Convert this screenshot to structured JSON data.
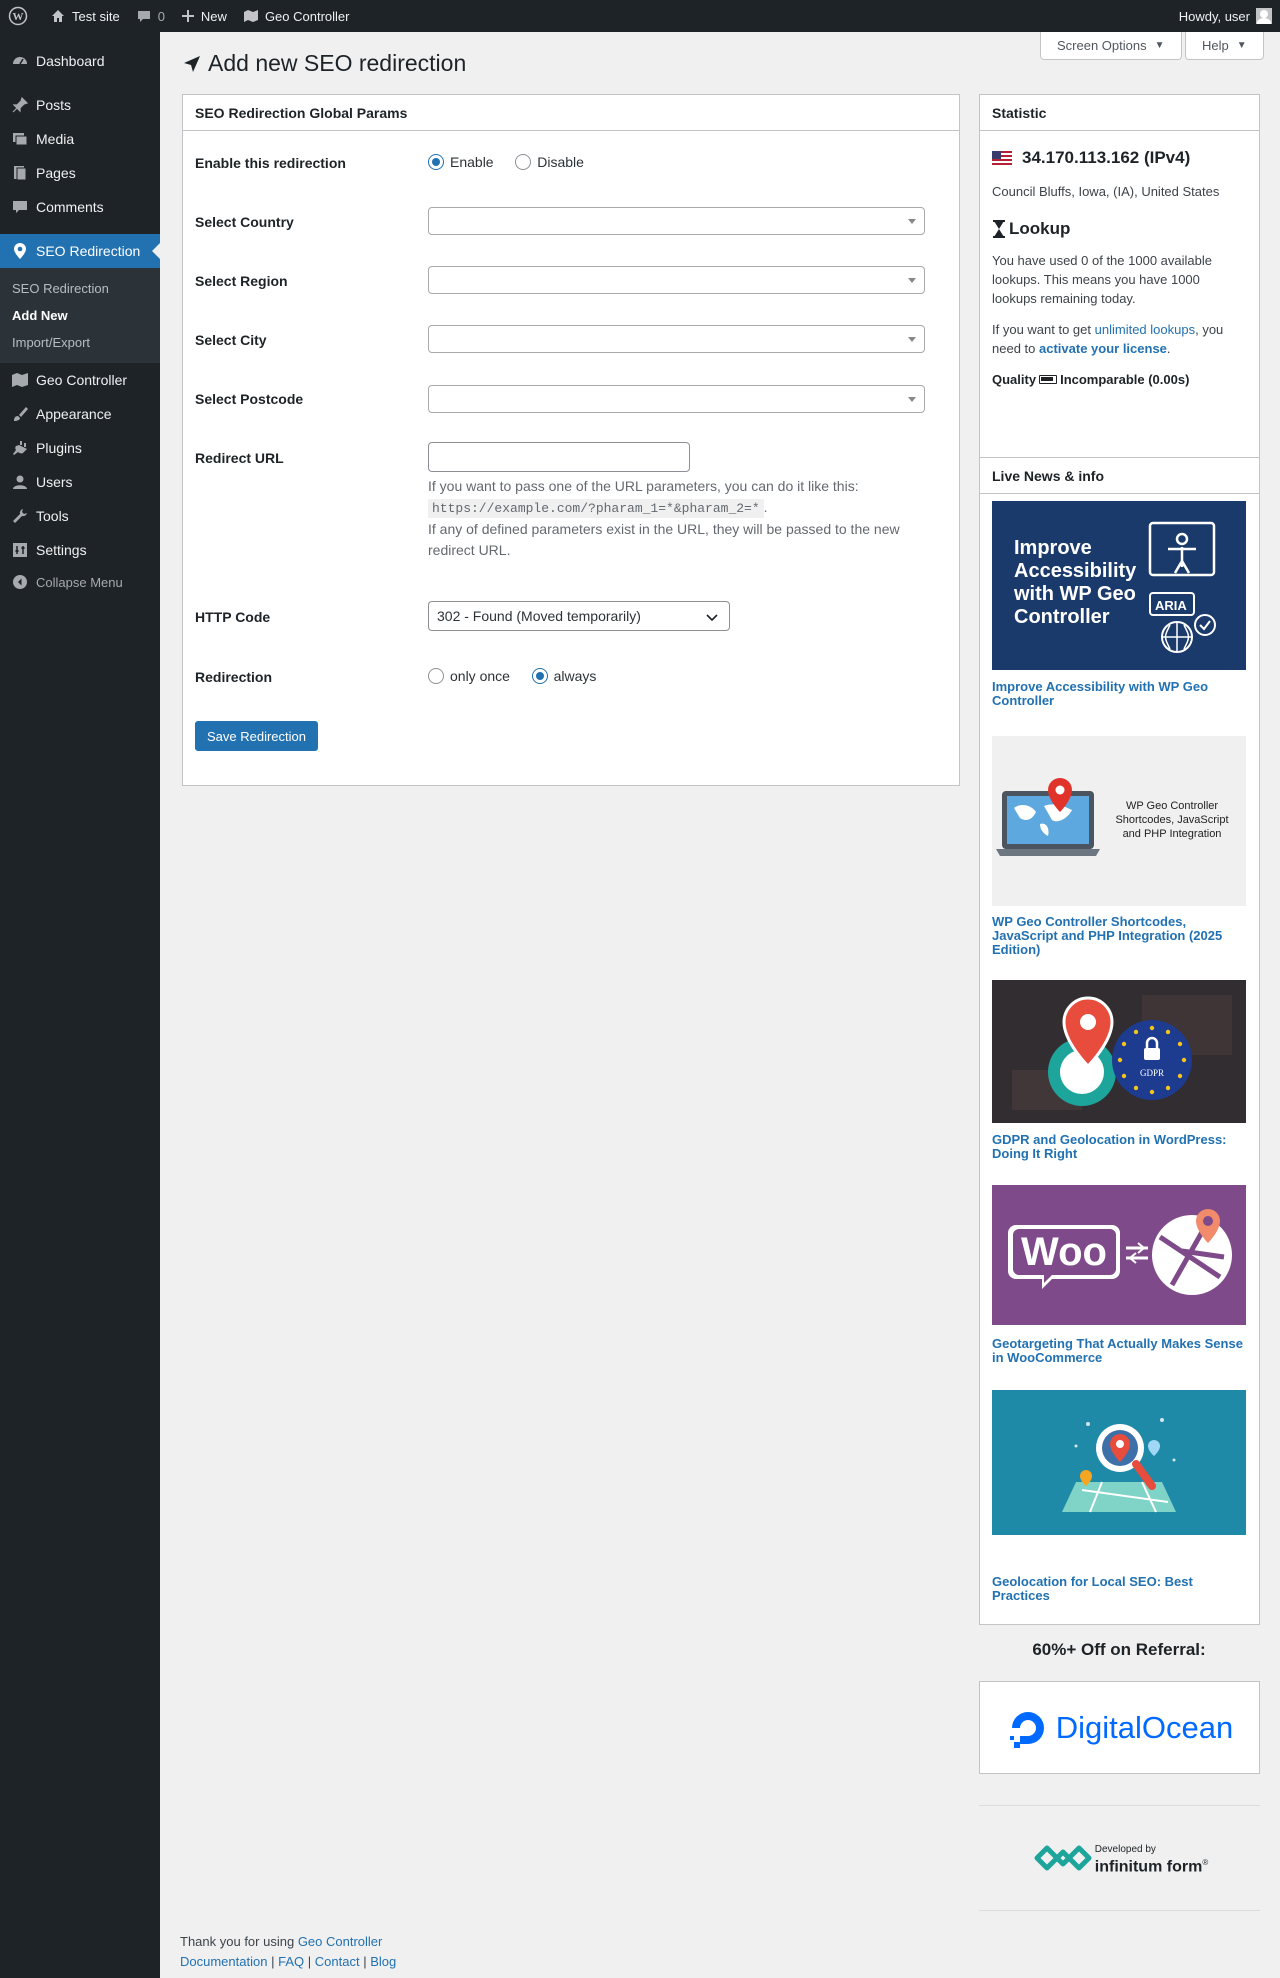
{
  "adminbar": {
    "site_name": "Test site",
    "comments_count": "0",
    "new_label": "New",
    "plugin_label": "Geo Controller",
    "howdy": "Howdy, user"
  },
  "sidebar": {
    "items": [
      {
        "label": "Dashboard",
        "icon": "dashboard-icon"
      },
      {
        "label": "Posts",
        "icon": "pin-icon"
      },
      {
        "label": "Media",
        "icon": "media-icon"
      },
      {
        "label": "Pages",
        "icon": "pages-icon"
      },
      {
        "label": "Comments",
        "icon": "comment-icon"
      },
      {
        "label": "SEO Redirection",
        "icon": "location-pin-icon"
      },
      {
        "label": "Geo Controller",
        "icon": "map-icon"
      },
      {
        "label": "Appearance",
        "icon": "brush-icon"
      },
      {
        "label": "Plugins",
        "icon": "plug-icon"
      },
      {
        "label": "Users",
        "icon": "user-icon"
      },
      {
        "label": "Tools",
        "icon": "wrench-icon"
      },
      {
        "label": "Settings",
        "icon": "settings-icon"
      }
    ],
    "submenu": [
      "SEO Redirection",
      "Add New",
      "Import/Export"
    ],
    "collapse": "Collapse Menu"
  },
  "header": {
    "screen_options": "Screen Options",
    "help": "Help",
    "title": "Add new SEO redirection"
  },
  "form": {
    "box_title": "SEO Redirection Global Params",
    "enable_label": "Enable this redirection",
    "enable_opt": "Enable",
    "disable_opt": "Disable",
    "country_label": "Select Country",
    "region_label": "Select Region",
    "city_label": "Select City",
    "postcode_label": "Select Postcode",
    "url_label": "Redirect URL",
    "url_value": "",
    "url_help_1": "If you want to pass one of the URL parameters, you can do it like this:",
    "url_help_code": "https://example.com/?pharam_1=*&pharam_2=*",
    "url_help_dot": ".",
    "url_help_2": "If any of defined parameters exist in the URL, they will be passed to the new redirect URL.",
    "http_label": "HTTP Code",
    "http_value": "302 - Found (Moved temporarily)",
    "redirection_label": "Redirection",
    "once_opt": "only once",
    "always_opt": "always",
    "save_label": "Save Redirection"
  },
  "statistic": {
    "title": "Statistic",
    "ip": "34.170.113.162 (IPv4)",
    "location": "Council Bluffs, Iowa, (IA), United States",
    "lookup_title": "Lookup",
    "lookup_text": "You have used 0 of the 1000 available lookups. This means you have 1000 lookups remaining today.",
    "license_pre": "If you want to get",
    "license_link1": "unlimited lookups",
    "license_mid": ", you need to",
    "license_link2": "activate your license",
    "license_end": ".",
    "quality_label": "Quality",
    "quality_value": "Incomparable (0.00s)"
  },
  "news": {
    "title": "Live News & info",
    "items": [
      {
        "title": "Improve Accessibility with WP Geo Controller",
        "img_text": "Improve Accessibility with WP Geo Controller",
        "badge": "ARIA"
      },
      {
        "title": "WP Geo Controller Shortcodes, JavaScript and PHP Integration (2025 Edition)",
        "img_text": "WP Geo Controller Shortcodes, JavaScript and PHP Integration"
      },
      {
        "title": "GDPR and Geolocation in WordPress: Doing It Right",
        "badge": "GDPR"
      },
      {
        "title": "Geotargeting That Actually Makes Sense in WooCommerce",
        "img_text": "Woo"
      },
      {
        "title": "Geolocation for Local SEO: Best Practices"
      }
    ]
  },
  "referral": {
    "title": "60%+ Off on Referral:",
    "brand": "DigitalOcean",
    "dev_small": "Developed by",
    "dev_brand": "infinitum form",
    "dev_mark": "®"
  },
  "footer": {
    "thanks": "Thank you for using",
    "thanks_link": "Geo Controller",
    "links": [
      "Documentation",
      "FAQ",
      "Contact",
      "Blog"
    ],
    "sep": "|"
  },
  "colors": {
    "accent": "#2271b1",
    "adminbar": "#1d2327",
    "bg": "#f0f0f1"
  }
}
